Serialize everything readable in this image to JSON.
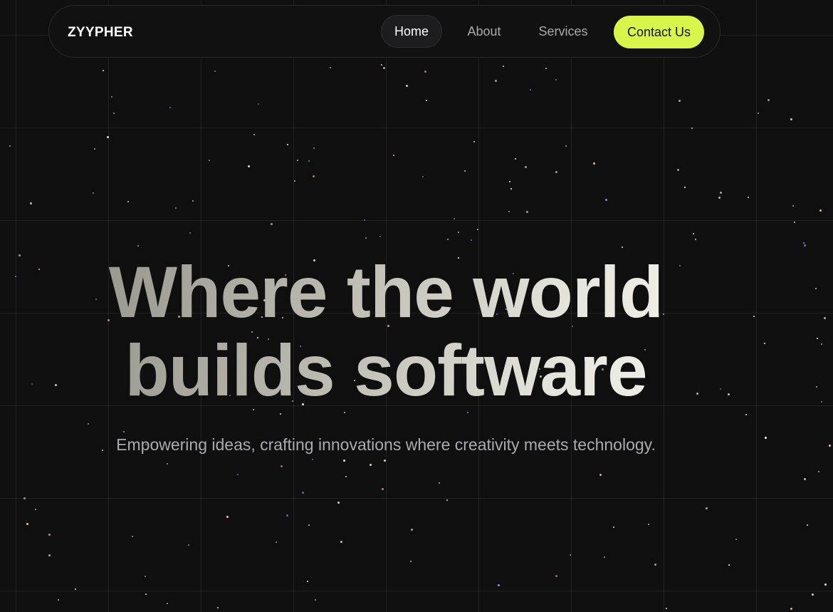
{
  "brand": {
    "name": "ZYYPHER"
  },
  "nav": {
    "items": [
      {
        "label": "Home"
      },
      {
        "label": "About"
      },
      {
        "label": "Services"
      }
    ],
    "cta_label": "Contact Us"
  },
  "hero": {
    "title_line1": "Where the world",
    "title_line2": "builds software",
    "subtitle": "Empowering ideas, crafting innovations where creativity meets technology."
  },
  "colors": {
    "background": "#0f0f10",
    "accent": "#d7f54a",
    "nav_text": "#a9a9ad",
    "subtitle_text": "#aaaab2"
  }
}
